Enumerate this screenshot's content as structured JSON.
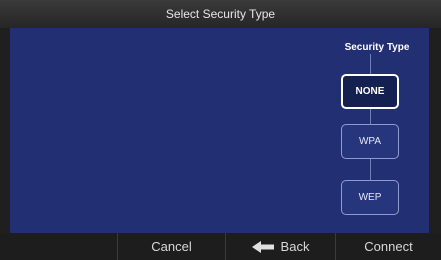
{
  "header": {
    "title": "Select Security Type"
  },
  "panel": {
    "label": "Security Type"
  },
  "options": [
    {
      "label": "NONE",
      "selected": true
    },
    {
      "label": "WPA",
      "selected": false
    },
    {
      "label": "WEP",
      "selected": false
    }
  ],
  "footer": {
    "cancel_label": "Cancel",
    "back_label": "Back",
    "back_icon": "left-arrow-icon",
    "connect_label": "Connect"
  },
  "colors": {
    "content_background": "#232f73",
    "selected_option_background": "#14204f",
    "option_background": "#27357c"
  }
}
